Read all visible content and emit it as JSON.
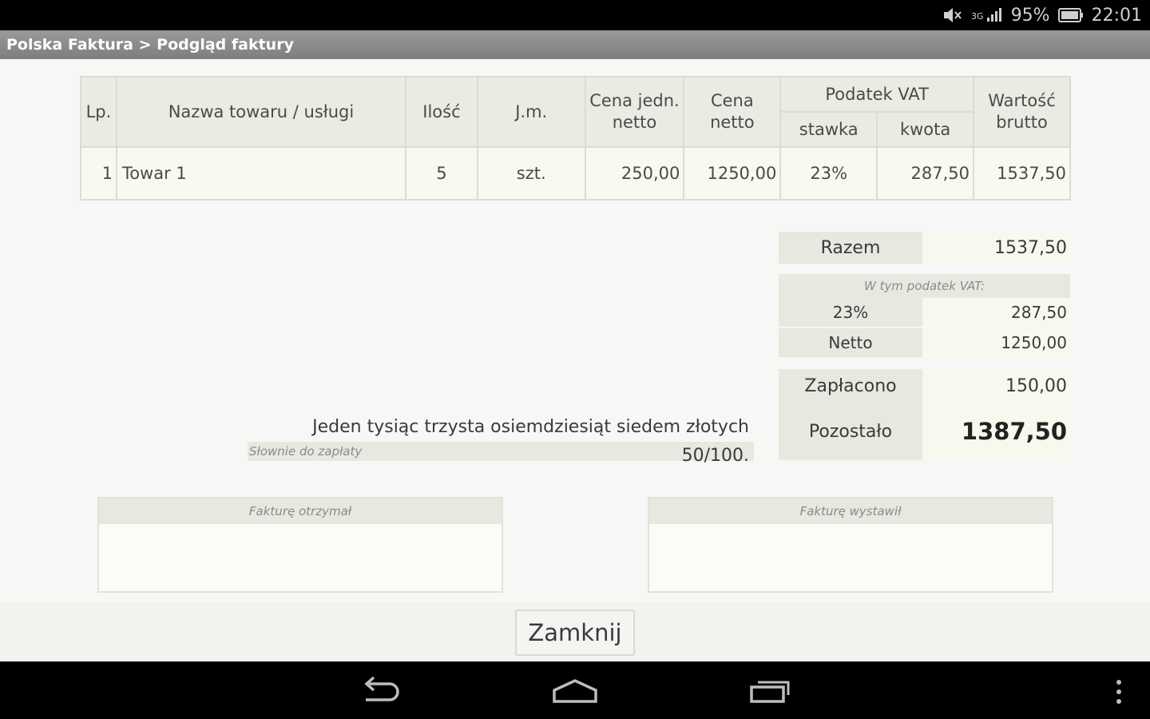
{
  "status": {
    "battery": "95%",
    "time": "22:01"
  },
  "title": "Polska Faktura > Podgląd faktury",
  "table": {
    "headers": {
      "lp": "Lp.",
      "name": "Nazwa towaru / usługi",
      "qty": "Ilość",
      "unit": "J.m.",
      "unit_price_1": "Cena jedn.",
      "unit_price_2": "netto",
      "net_1": "Cena",
      "net_2": "netto",
      "vat": "Podatek VAT",
      "vat_rate": "stawka",
      "vat_amount": "kwota",
      "gross_1": "Wartość",
      "gross_2": "brutto"
    },
    "rows": [
      {
        "lp": "1",
        "name": "Towar 1",
        "qty": "5",
        "unit": "szt.",
        "unit_price": "250,00",
        "net": "1250,00",
        "vat_rate": "23%",
        "vat_amount": "287,50",
        "gross": "1537,50"
      }
    ]
  },
  "summary": {
    "total_label": "Razem",
    "total_value": "1537,50",
    "vat_caption": "W tym podatek VAT:",
    "vat_rate": "23%",
    "vat_value": "287,50",
    "net_label": "Netto",
    "net_value": "1250,00",
    "paid_label": "Zapłacono",
    "paid_value": "150,00",
    "remaining_label": "Pozostało",
    "remaining_value": "1387,50"
  },
  "words": {
    "text": "Jeden tysiąc trzysta osiemdziesiąt siedem złotych 50/100.",
    "caption": "Słownie do zapłaty"
  },
  "signatures": {
    "received": "Fakturę otrzymał",
    "issued": "Fakturę wystawił"
  },
  "close_button": "Zamknij"
}
